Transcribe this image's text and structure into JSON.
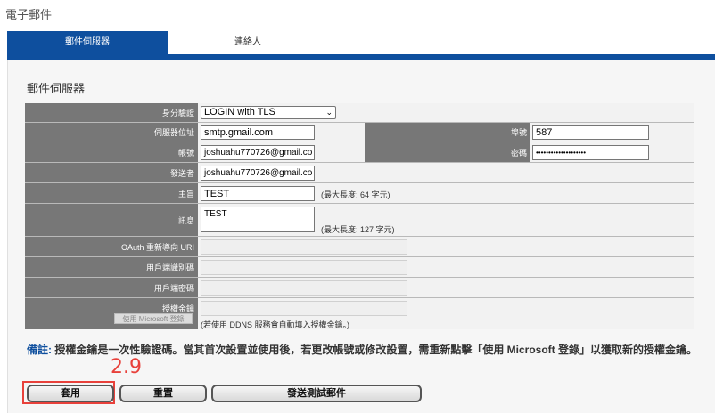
{
  "page": {
    "title": "電子郵件"
  },
  "tabs": [
    {
      "label": "郵件伺服器",
      "active": true
    },
    {
      "label": "連絡人",
      "active": false
    }
  ],
  "section": {
    "title": "郵件伺服器"
  },
  "form": {
    "auth": {
      "label": "身分驗證",
      "value": "LOGIN with TLS"
    },
    "server": {
      "label": "伺服器位址",
      "value": "smtp.gmail.com"
    },
    "port": {
      "label": "埠號",
      "value": "587"
    },
    "account": {
      "label": "帳號",
      "value": "joshuahu770726@gmail.co"
    },
    "password": {
      "label": "密碼",
      "value": "••••••••••••••••••••"
    },
    "sender": {
      "label": "發送者",
      "value": "joshuahu770726@gmail.co"
    },
    "subject": {
      "label": "主旨",
      "value": "TEST",
      "note": "(最大長度: 64 字元)"
    },
    "message": {
      "label": "訊息",
      "value": "TEST",
      "note": "(最大長度: 127 字元)"
    },
    "oauth_uri": {
      "label": "OAuth 重新導向 URI",
      "value": ""
    },
    "client_id": {
      "label": "用戶端識別碼",
      "value": ""
    },
    "client_secret": {
      "label": "用戶端密碼",
      "value": ""
    },
    "auth_key": {
      "label": "授權金鑰",
      "value": "",
      "button": "使用 Microsoft 登錄",
      "note": "(若使用 DDNS 服務會自動填入授權金鑰。)"
    }
  },
  "remark": {
    "label": "備註:",
    "text": " 授權金鑰是一次性驗證碼。當其首次設置並使用後，若更改帳號或修改設置，需重新點擊「使用 Microsoft 登錄」以獲取新的授權金鑰。"
  },
  "annotation": {
    "step": "2.9",
    "color": "#e8413b"
  },
  "buttons": {
    "apply": "套用",
    "reset": "重置",
    "send_test": "發送測試郵件"
  },
  "colors": {
    "accent": "#0e4f9e",
    "label_bg": "#777777"
  }
}
